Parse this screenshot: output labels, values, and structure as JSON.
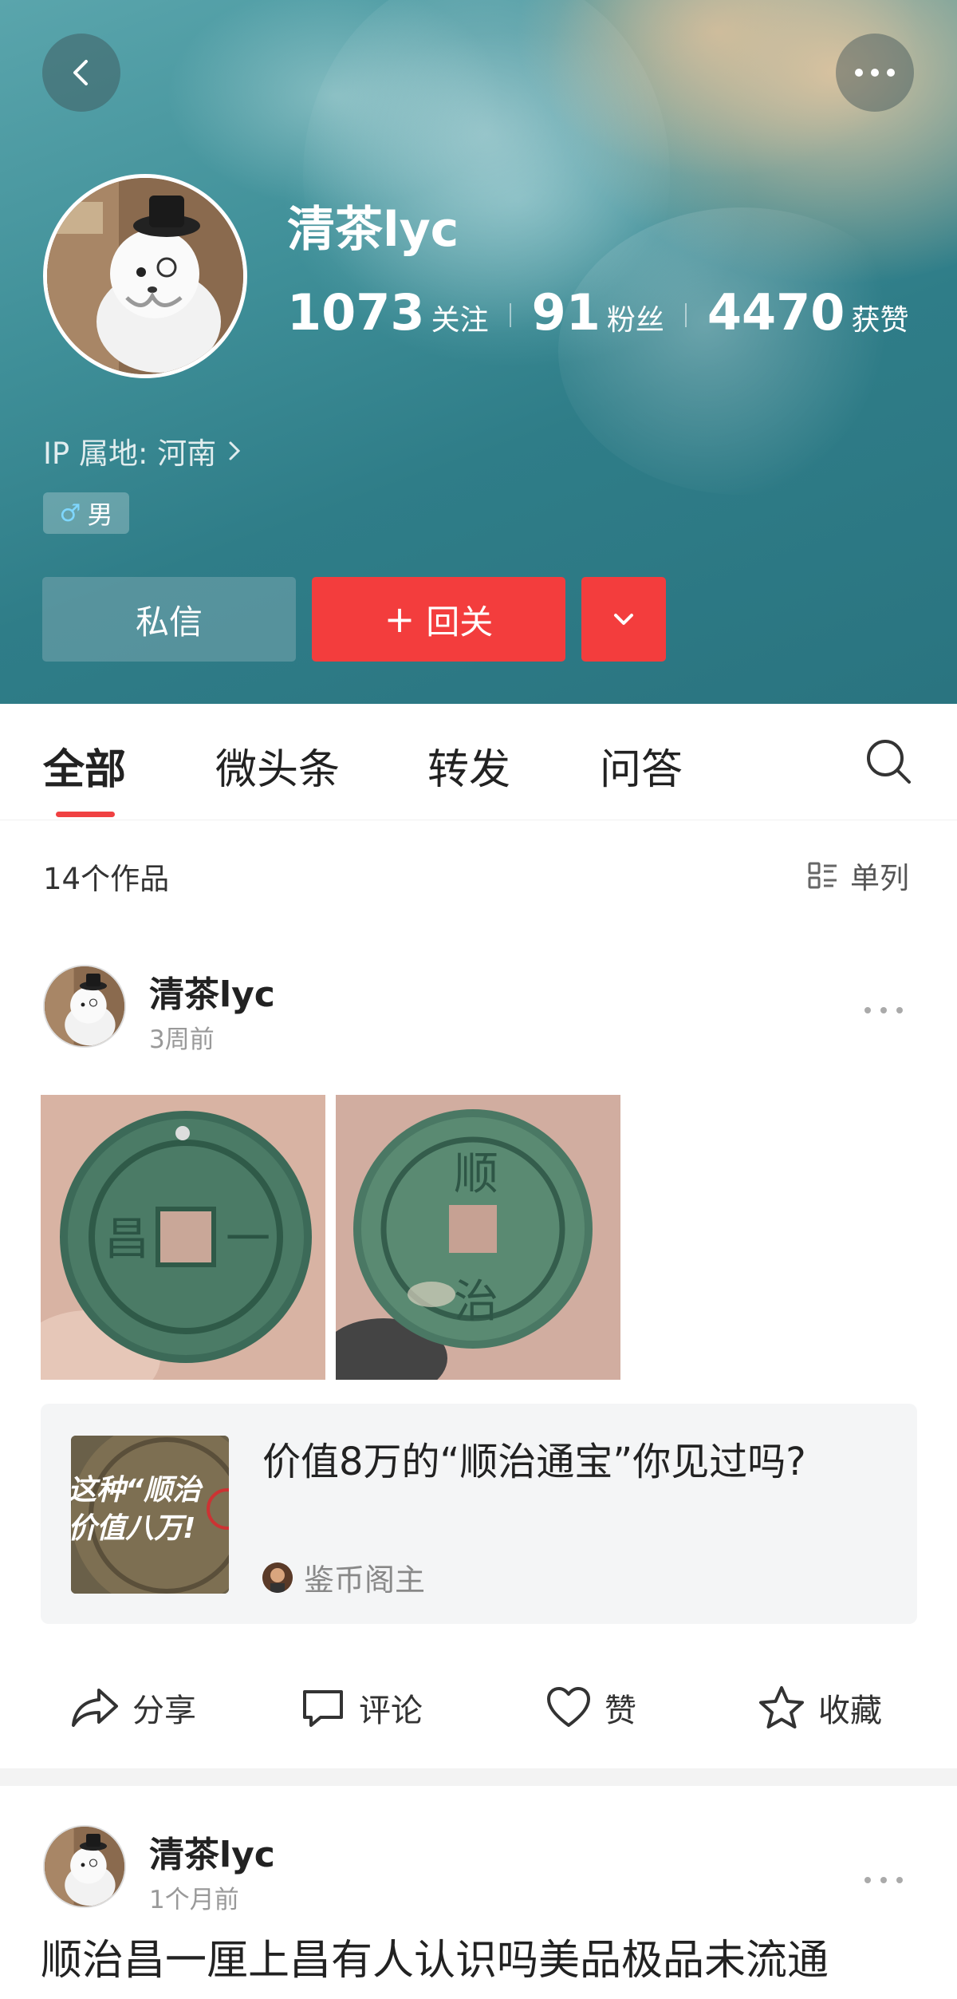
{
  "header": {
    "username": "清茶lyc",
    "stats": [
      {
        "value": "1073",
        "label": "关注"
      },
      {
        "value": "91",
        "label": "粉丝"
      },
      {
        "value": "4470",
        "label": "获赞"
      }
    ],
    "ip_location": "IP 属地: 河南",
    "gender": "男",
    "message_button": "私信",
    "follow_button": "回关"
  },
  "tabs": [
    {
      "label": "全部",
      "active": true
    },
    {
      "label": "微头条",
      "active": false
    },
    {
      "label": "转发",
      "active": false
    },
    {
      "label": "问答",
      "active": false
    }
  ],
  "works": {
    "count": "14个作品",
    "view_mode": "单列"
  },
  "posts": [
    {
      "author": "清茶lyc",
      "time": "3周前",
      "shared": {
        "title": "价值8万的“顺治通宝”你见过吗?",
        "thumb_text_line1": "这种“顺治",
        "thumb_text_line2": "价值八万!",
        "author": "鉴币阁主"
      },
      "actions": {
        "share": "分享",
        "comment": "评论",
        "like": "赞",
        "favorite": "收藏"
      }
    },
    {
      "author": "清茶lyc",
      "time": "1个月前",
      "text": "顺治昌一厘上昌有人认识吗美品极品未流通"
    }
  ],
  "icons": {
    "back": "chevron-left-icon",
    "more": "more-horizontal-icon",
    "search": "search-icon",
    "list": "list-view-icon",
    "share": "share-arrow-icon",
    "comment": "comment-bubble-icon",
    "like": "heart-icon",
    "favorite": "star-icon"
  },
  "colors": {
    "accent": "#f33d3d",
    "cover_teal": "#3f8f98"
  }
}
